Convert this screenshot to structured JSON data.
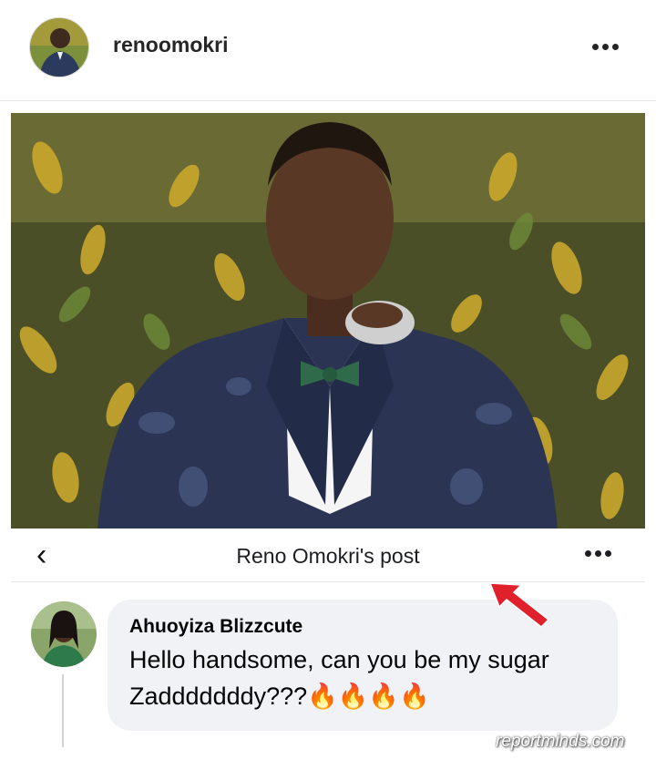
{
  "header": {
    "username": "renoomokri",
    "avatar_icon": "profile-photo",
    "more_icon": "more-horizontal-icon"
  },
  "post": {
    "photo_icon": "portrait-photo"
  },
  "fb_screenshot": {
    "back_icon": "chevron-left-icon",
    "title": "Reno Omokri's post",
    "more_icon": "more-horizontal-icon",
    "comment": {
      "author": "Ahuoyiza Blizzcute",
      "text": "Hello handsome, can you be my sugar Zadddddddy???🔥🔥🔥🔥"
    }
  },
  "watermark": "reportminds.com",
  "colors": {
    "bubble": "#f0f2f5",
    "arrow": "#e0202a"
  }
}
